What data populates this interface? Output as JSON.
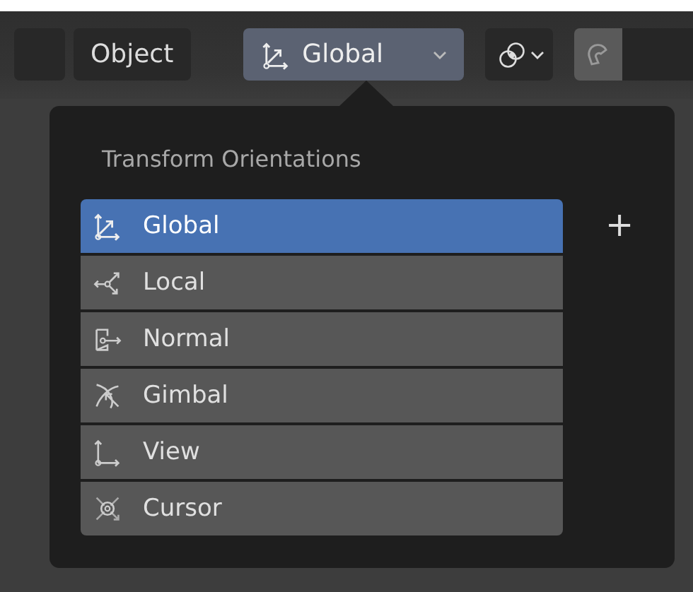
{
  "header": {
    "mode_button": "Object",
    "orientation_dropdown": "Global"
  },
  "popup": {
    "title": "Transform Orientations",
    "add_button": "+",
    "items": [
      {
        "label": "Global",
        "selected": true
      },
      {
        "label": "Local",
        "selected": false
      },
      {
        "label": "Normal",
        "selected": false
      },
      {
        "label": "Gimbal",
        "selected": false
      },
      {
        "label": "View",
        "selected": false
      },
      {
        "label": "Cursor",
        "selected": false
      }
    ]
  }
}
